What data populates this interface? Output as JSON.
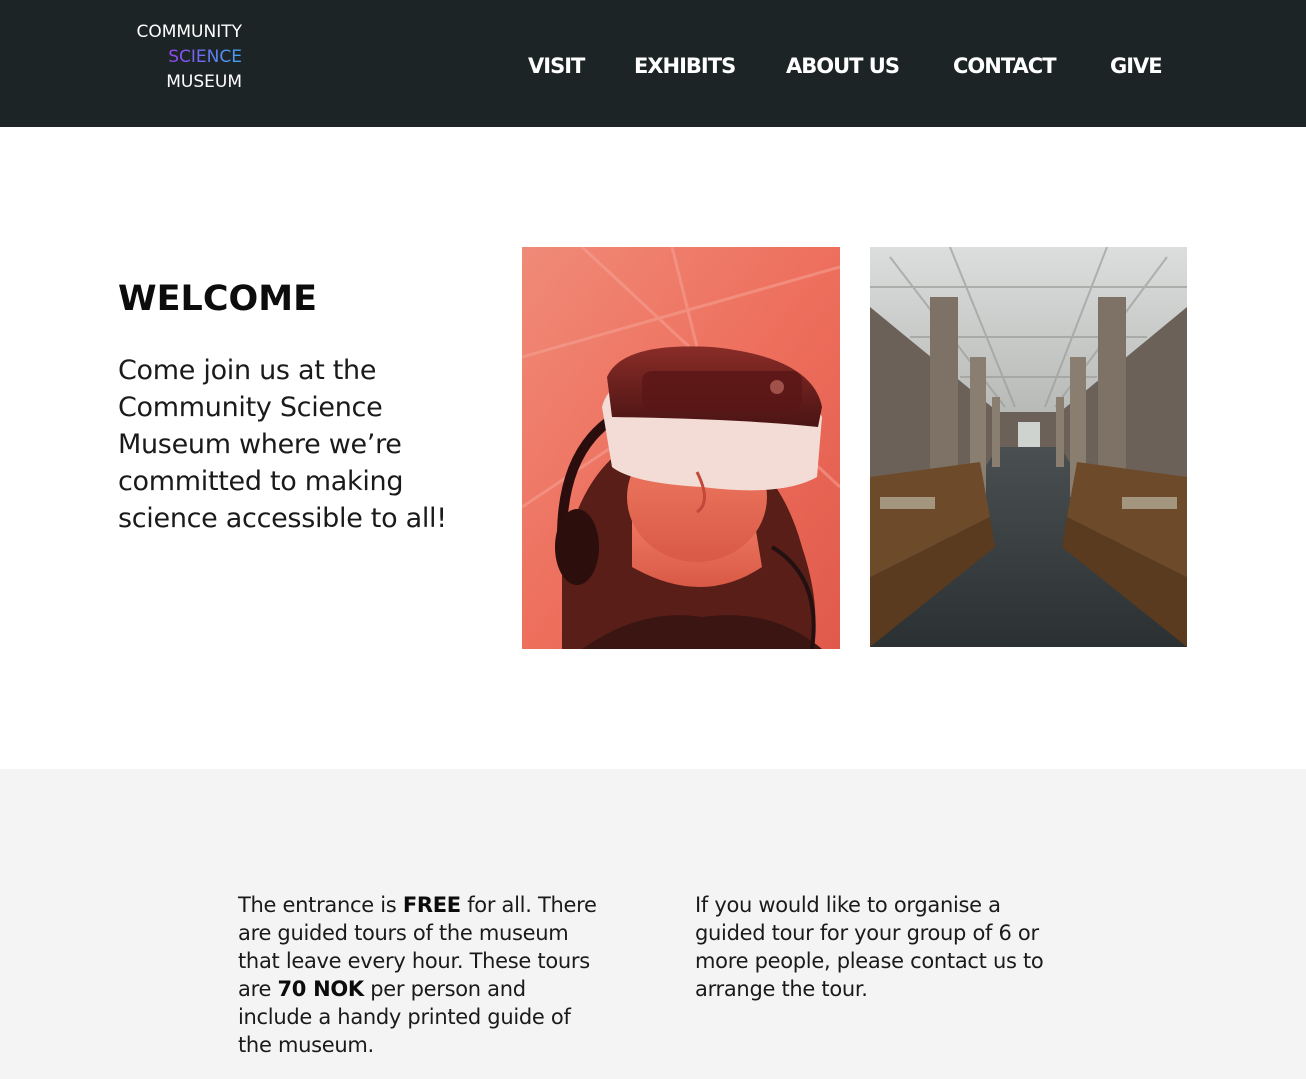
{
  "brand": {
    "line1": "COMMUNITY",
    "line2": "SCIENCE",
    "line3": "MUSEUM",
    "gradient_colors": [
      "#c13ddd",
      "#8a4cf0",
      "#3fa7f5"
    ]
  },
  "nav": {
    "items": [
      {
        "label": "VISIT"
      },
      {
        "label": "EXHIBITS"
      },
      {
        "label": "ABOUT US"
      },
      {
        "label": "CONTACT"
      },
      {
        "label": "GIVE"
      }
    ]
  },
  "welcome": {
    "title": "WELCOME",
    "body": "Come join us at the Community Science Museum where we’re committed to making science accessible to all!"
  },
  "info": {
    "left": {
      "p1": "The entrance is ",
      "free": "FREE",
      "p2": " for all. There are guided tours of the museum that leave every hour. These tours are ",
      "price": "70 NOK",
      "p3": " per person and include a handy printed guide of the museum."
    },
    "right": {
      "text": "If you would like to organise a guided tour for your group of 6 or more people, please contact us to arrange the tour."
    }
  },
  "colors": {
    "header_bg": "#1d2426",
    "info_bg": "#f4f4f4",
    "text": "#1a1a1a"
  }
}
